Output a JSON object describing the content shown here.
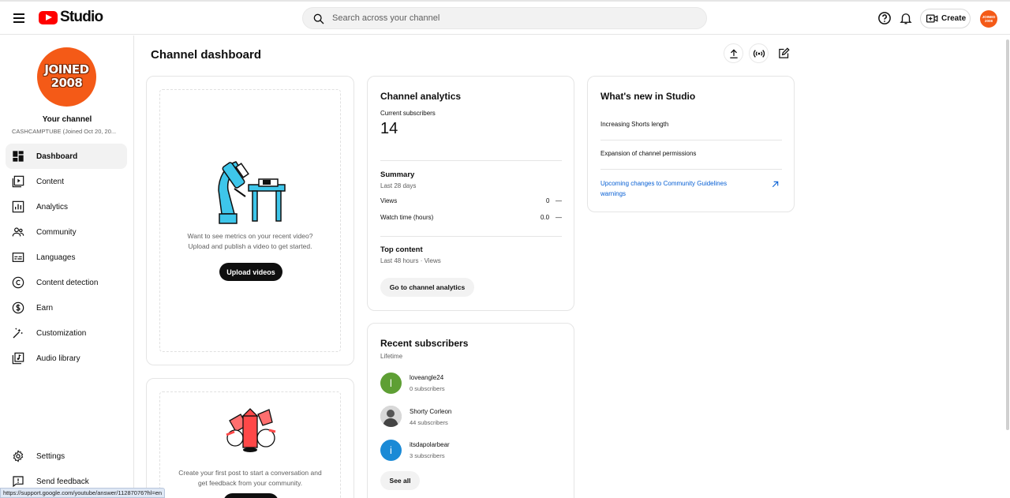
{
  "header": {
    "logo_text": "Studio",
    "search_placeholder": "Search across your channel",
    "create_label": "Create",
    "avatar_text": "JOINED 2008"
  },
  "sidebar": {
    "avatar_line1": "JOINED",
    "avatar_line2": "2008",
    "your_channel": "Your channel",
    "channel_name": "CASHCAMPTUBE (Joined Oct 20, 20...",
    "items": [
      {
        "label": "Dashboard",
        "icon": "dashboard-icon",
        "active": true
      },
      {
        "label": "Content",
        "icon": "content-icon"
      },
      {
        "label": "Analytics",
        "icon": "analytics-icon"
      },
      {
        "label": "Community",
        "icon": "community-icon"
      },
      {
        "label": "Languages",
        "icon": "languages-icon"
      },
      {
        "label": "Content detection",
        "icon": "copyright-icon"
      },
      {
        "label": "Earn",
        "icon": "dollar-icon"
      },
      {
        "label": "Customization",
        "icon": "magic-wand-icon"
      },
      {
        "label": "Audio library",
        "icon": "audio-library-icon"
      }
    ],
    "settings_label": "Settings",
    "feedback_label": "Send feedback"
  },
  "main": {
    "title": "Channel dashboard",
    "upload_card": {
      "text_line1": "Want to see metrics on your recent video?",
      "text_line2": "Upload and publish a video to get started.",
      "button": "Upload videos"
    },
    "post_card": {
      "text_line1": "Create your first post to start a conversation and",
      "text_line2": "get feedback from your community."
    },
    "analytics": {
      "title": "Channel analytics",
      "current_subs_label": "Current subscribers",
      "current_subs_value": "14",
      "summary_label": "Summary",
      "summary_period": "Last 28 days",
      "rows": [
        {
          "label": "Views",
          "value": "0",
          "trend": "—"
        },
        {
          "label": "Watch time (hours)",
          "value": "0.0",
          "trend": "—"
        }
      ],
      "top_content_label": "Top content",
      "top_content_period": "Last 48 hours · Views",
      "button": "Go to channel analytics"
    },
    "recent_subs": {
      "title": "Recent subscribers",
      "period": "Lifetime",
      "subs": [
        {
          "initial": "l",
          "name": "loveangle24",
          "count": "0 subscribers",
          "color": "#5e9f34"
        },
        {
          "initial": "",
          "name": "Shorty Corleon",
          "count": "44 subscribers",
          "color": "#9a9a9a"
        },
        {
          "initial": "i",
          "name": "itsdapolarbear",
          "count": "3 subscribers",
          "color": "#1a8ad6"
        }
      ],
      "button": "See all"
    },
    "whats_new": {
      "title": "What's new in Studio",
      "items": [
        "Increasing Shorts length",
        "Expansion of channel permissions"
      ],
      "link": "Upcoming changes to Community Guidelines warnings"
    }
  },
  "status_url": "https://support.google.com/youtube/answer/11287076?hl=en"
}
